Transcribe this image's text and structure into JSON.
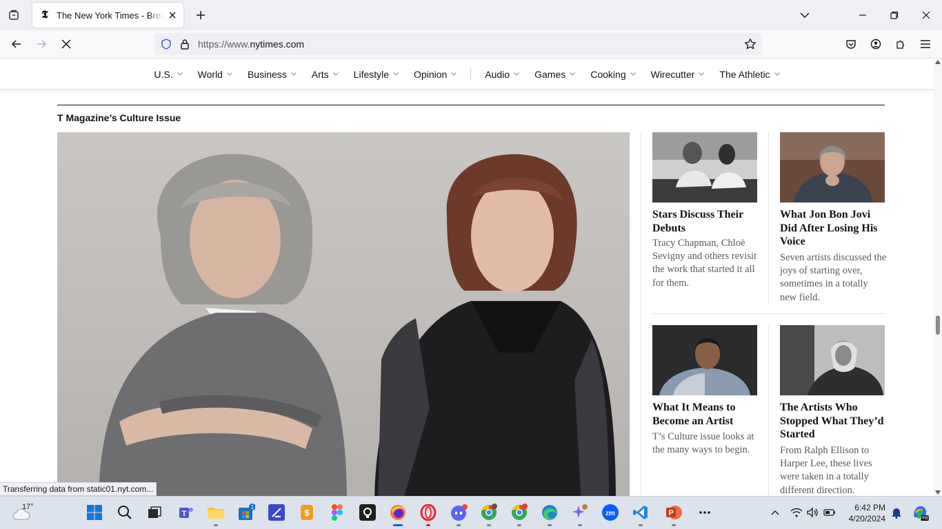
{
  "browser": {
    "tab_title": "The New York Times - Breaking News, US News, World News and Videos",
    "url_prefix": "https://www.",
    "url_host": "nytimes.com",
    "status_text": "Transferring data from static01.nyt.com..."
  },
  "nav": {
    "sections": [
      "U.S.",
      "World",
      "Business",
      "Arts",
      "Lifestyle",
      "Opinion"
    ],
    "sections_more": [
      "Audio",
      "Games",
      "Cooking",
      "Wirecutter",
      "The Athletic"
    ]
  },
  "page": {
    "kicker": "T Magazine’s Culture Issue",
    "hero_alt": "Jane Fonda and Lily Tomlin",
    "cards": [
      {
        "headline": "Stars Discuss Their Debuts",
        "summary": "Tracy Chapman, Chloë Sevigny and others revisit the work that started it all for them."
      },
      {
        "headline": "What Jon Bon Jovi Did After Losing His Voice",
        "summary": "Seven artists discussed the joys of starting over, sometimes in a totally new field."
      },
      {
        "headline": "What It Means to Become an Artist",
        "summary": "T’s Culture issue looks at the many ways to begin."
      },
      {
        "headline": "The Artists Who Stopped What They’d Started",
        "summary": "From Ralph Ellison to Harper Lee, these lives were taken in a totally different direction."
      }
    ]
  },
  "taskbar": {
    "weather_temp": "17°",
    "time": "6:42 PM",
    "date": "4/20/2024",
    "store_badge": "1"
  },
  "colors": {
    "chrome_bg": "#f0f0f4",
    "taskbar_bg": "#dde3ec",
    "text_primary": "#121212",
    "text_secondary": "#5a5a5a"
  }
}
